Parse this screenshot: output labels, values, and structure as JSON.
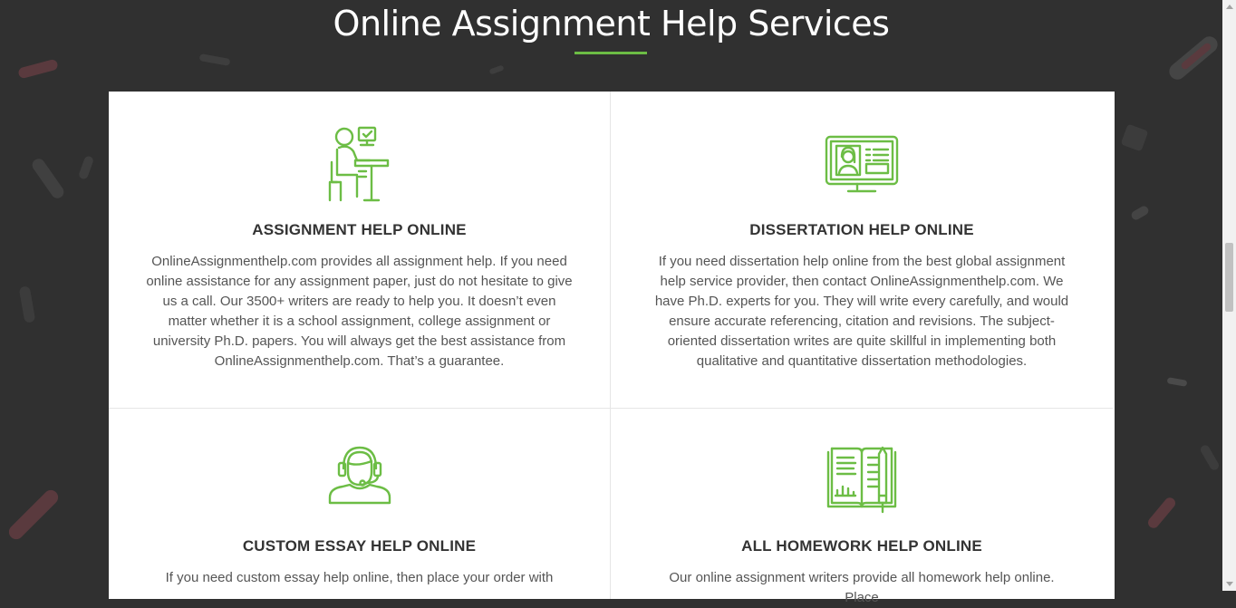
{
  "section": {
    "title": "Online Assignment Help Services"
  },
  "colors": {
    "accent": "#6cbd45",
    "background": "#303030",
    "card": "#ffffff"
  },
  "services": [
    {
      "icon": "person-at-computer-icon",
      "title": "ASSIGNMENT HELP ONLINE",
      "text": "OnlineAssignmenthelp.com provides all assignment help. If you need online assistance for any assignment paper, just do not hesitate to give us a call. Our 3500+ writers are ready to help you. It doesn’t even matter whether it is a school assignment, college assignment or university Ph.D. papers. You will always get the best assistance from OnlineAssignmenthelp.com. That’s a guarantee."
    },
    {
      "icon": "online-profile-monitor-icon",
      "title": "DISSERTATION HELP ONLINE",
      "text": "If you need dissertation help online from the best global assignment help service provider, then contact OnlineAssignmenthelp.com. We have Ph.D. experts for you. They will write every carefully, and would ensure accurate referencing, citation and revisions. The subject-oriented dissertation writes are quite skillful in implementing both qualitative and quantitative dissertation methodologies."
    },
    {
      "icon": "headset-support-agent-icon",
      "title": "CUSTOM ESSAY HELP ONLINE",
      "text": "If you need custom essay help online, then place your order with"
    },
    {
      "icon": "open-book-pencil-icon",
      "title": "ALL HOMEWORK HELP ONLINE",
      "text": "Our online assignment writers provide all homework help online. Place"
    }
  ]
}
